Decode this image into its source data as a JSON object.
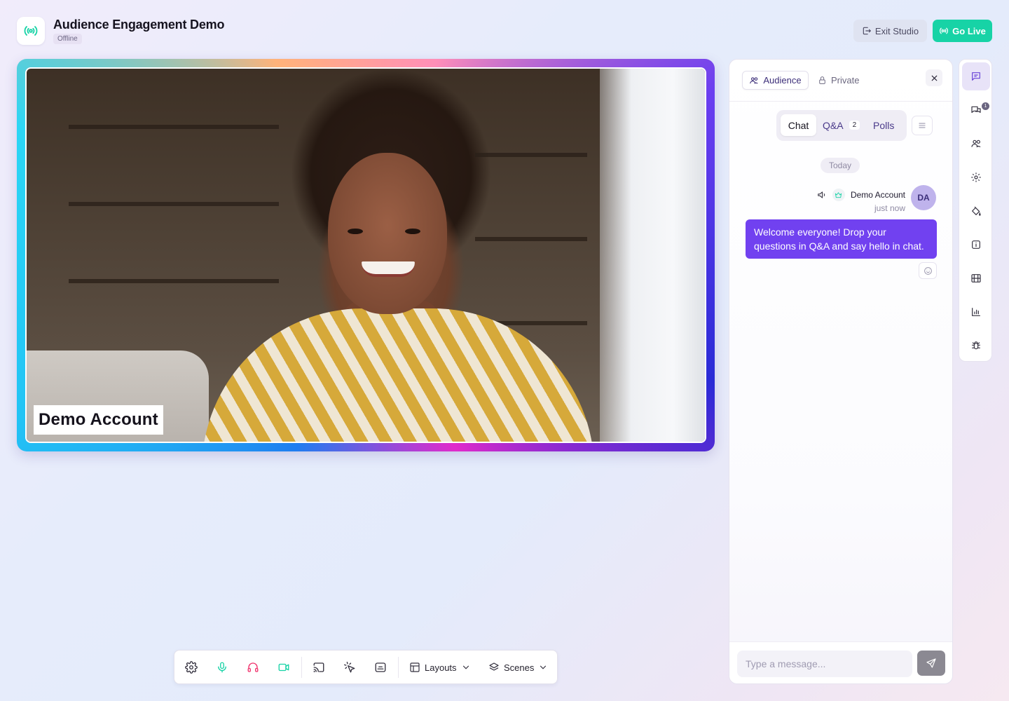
{
  "header": {
    "title": "Audience Engagement Demo",
    "status": "Offline",
    "exit_label": "Exit Studio",
    "live_label": "Go Live"
  },
  "stage": {
    "name_tag": "Demo Account"
  },
  "toolbar": {
    "layouts_label": "Layouts",
    "scenes_label": "Scenes"
  },
  "panel": {
    "tabs": {
      "audience": "Audience",
      "private": "Private"
    },
    "segments": {
      "chat": "Chat",
      "qa": "Q&A",
      "qa_count": "2",
      "polls": "Polls"
    },
    "day_label": "Today",
    "message": {
      "author": "Demo Account",
      "time": "just now",
      "initials": "DA",
      "text": "Welcome everyone! Drop your questions in Q&A and say hello in chat."
    },
    "composer": {
      "placeholder": "Type a message..."
    }
  },
  "rail": {
    "badge_count": "1",
    "items": [
      "chat-icon",
      "comments-icon",
      "users-icon",
      "settings-icon",
      "paint-bucket-icon",
      "info-icon",
      "film-icon",
      "bar-chart-icon",
      "bug-icon"
    ]
  },
  "colors": {
    "accent_green": "#17d3a6",
    "accent_purple": "#7141f0",
    "avatar_bg": "#bfb3ec"
  }
}
